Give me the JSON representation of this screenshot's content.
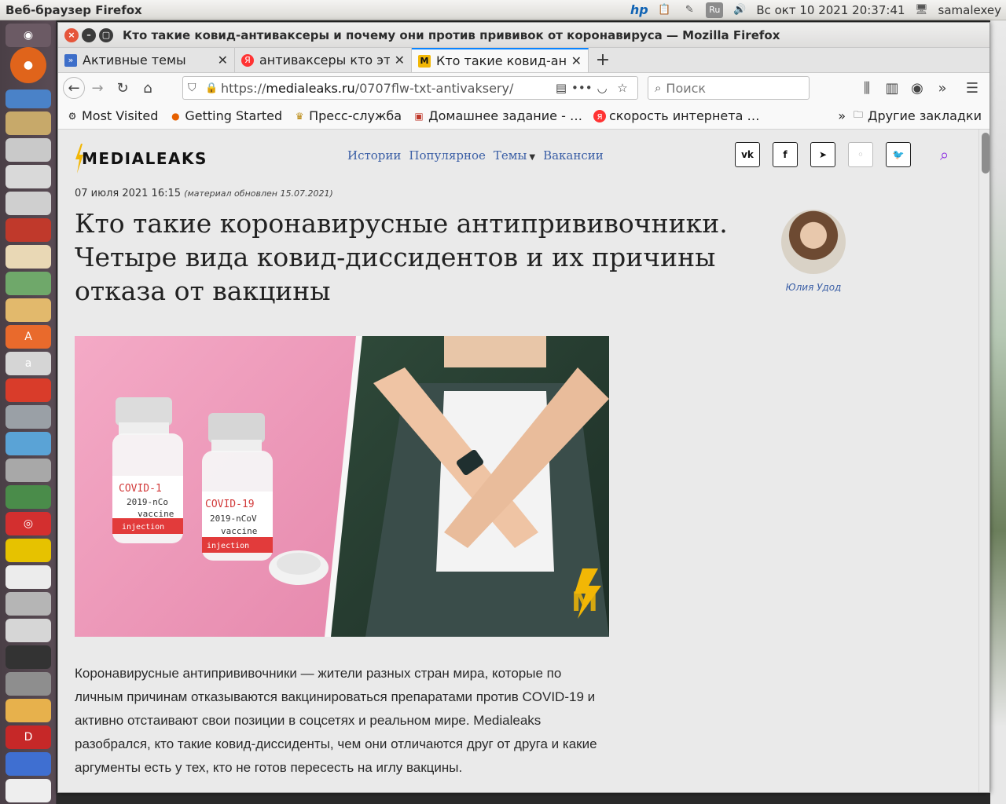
{
  "system": {
    "app_name": "Веб-браузер Firefox",
    "clock": "Вс окт 10 2021 20:37:41",
    "user": "samalexey",
    "keyboard_layout": "Ru",
    "hp_label": "hp"
  },
  "window": {
    "title": "Кто такие ковид-антиваксеры и почему они против прививок от коронавируса — Mozilla Firefox"
  },
  "tabs": [
    {
      "label": "Активные темы",
      "icon": "forum-favicon",
      "active": false
    },
    {
      "label": "антиваксеры кто это",
      "icon": "yandex-favicon",
      "active": false
    },
    {
      "label": "Кто такие ковид-антиваксеры",
      "icon": "medialeaks-favicon",
      "active": true
    }
  ],
  "navbar": {
    "url_prefix": "https://",
    "url_domain": "medialeaks.ru",
    "url_path": "/0707flw-txt-antivaksery/",
    "search_placeholder": "Поиск"
  },
  "bookmarks": [
    {
      "label": "Most Visited",
      "icon": "gear-icon"
    },
    {
      "label": "Getting Started",
      "icon": "firefox-favicon"
    },
    {
      "label": "Пресс-служба",
      "icon": "emblem-favicon"
    },
    {
      "label": "Домашнее задание - …",
      "icon": "school-favicon"
    },
    {
      "label": "скорость интернета …",
      "icon": "yandex-favicon"
    }
  ],
  "bookmarks_other": "Другие закладки",
  "site": {
    "logo_text": "MEDIALEAKS",
    "nav": [
      "Истории",
      "Популярное",
      "Темы",
      "Вакансии"
    ],
    "social": [
      "vk",
      "f",
      "telegram",
      "ok",
      "twitter"
    ]
  },
  "article": {
    "date": "07 июля 2021 16:15",
    "updated": "(материал обновлен 15.07.2021)",
    "title": "Кто такие коронавирусные антипрививочники. Четыре вида ковид-диссидентов и их причины отказа от вакцины",
    "author": "Юлия Удод",
    "image_text": {
      "vial1_line1": "COVID-1",
      "vial1_line2": "2019-nCo",
      "vial1_line3": "vaccine",
      "vial1_line4": "injection",
      "vial2_line1": "COVID-19",
      "vial2_line2": "2019-nCoV",
      "vial2_line3": "vaccine",
      "vial2_line4": "injection"
    },
    "lead": "Коронавирусные антипрививочники — жители разных стран мира, которые по личным причинам отказываются вакцинироваться препаратами против COVID-19 и активно отстаивают свои позиции в соцсетях и реальном мире. Medialeaks разобрался, кто такие ковид-диссиденты, чем они отличаются друг от друга и какие аргументы есть у тех, кто не готов пересесть на иглу вакцины."
  },
  "colors": {
    "accent": "#0a84ff",
    "link": "#3b5fa6",
    "site_search": "#8a2be2",
    "logo_bolt": "#f2b705",
    "close_button": "#e5553a"
  }
}
